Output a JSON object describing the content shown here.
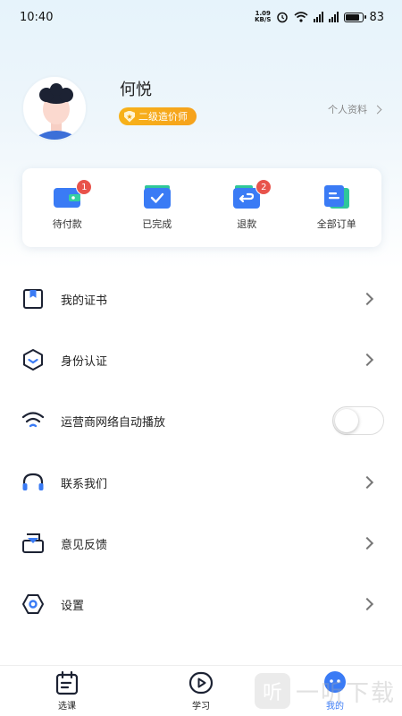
{
  "status_bar": {
    "time": "10:40",
    "net_speed_value": "1.09",
    "net_speed_unit": "KB/S",
    "battery": "83",
    "battery_level": 0.83
  },
  "profile": {
    "name": "何悦",
    "level": "二级造价师",
    "profile_link": "个人资料"
  },
  "orders": [
    {
      "label": "待付款",
      "badge": "1",
      "icon": "wallet-icon"
    },
    {
      "label": "已完成",
      "badge": "",
      "icon": "completed-icon"
    },
    {
      "label": "退款",
      "badge": "2",
      "icon": "refund-icon"
    },
    {
      "label": "全部订单",
      "badge": "",
      "icon": "all-orders-icon"
    }
  ],
  "menu": [
    {
      "label": "我的证书",
      "icon": "certificate-icon",
      "control": "chevron"
    },
    {
      "label": "身份认证",
      "icon": "identity-icon",
      "control": "chevron"
    },
    {
      "label": "运营商网络自动播放",
      "icon": "wifi-icon",
      "control": "toggle",
      "toggle_on": false
    },
    {
      "label": "联系我们",
      "icon": "headset-icon",
      "control": "chevron"
    },
    {
      "label": "意见反馈",
      "icon": "feedback-icon",
      "control": "chevron"
    },
    {
      "label": "设置",
      "icon": "settings-icon",
      "control": "chevron"
    }
  ],
  "bottom_nav": [
    {
      "label": "选课",
      "icon": "calendar-icon",
      "active": false
    },
    {
      "label": "学习",
      "icon": "play-icon",
      "active": false
    },
    {
      "label": "我的",
      "icon": "mine-icon",
      "active": true
    }
  ],
  "colors": {
    "accent": "#3a7bf5",
    "badge": "#e8534b",
    "level_badge": "#f6a21c"
  },
  "watermark": {
    "logo_glyph": "听",
    "text": "一听下载"
  }
}
